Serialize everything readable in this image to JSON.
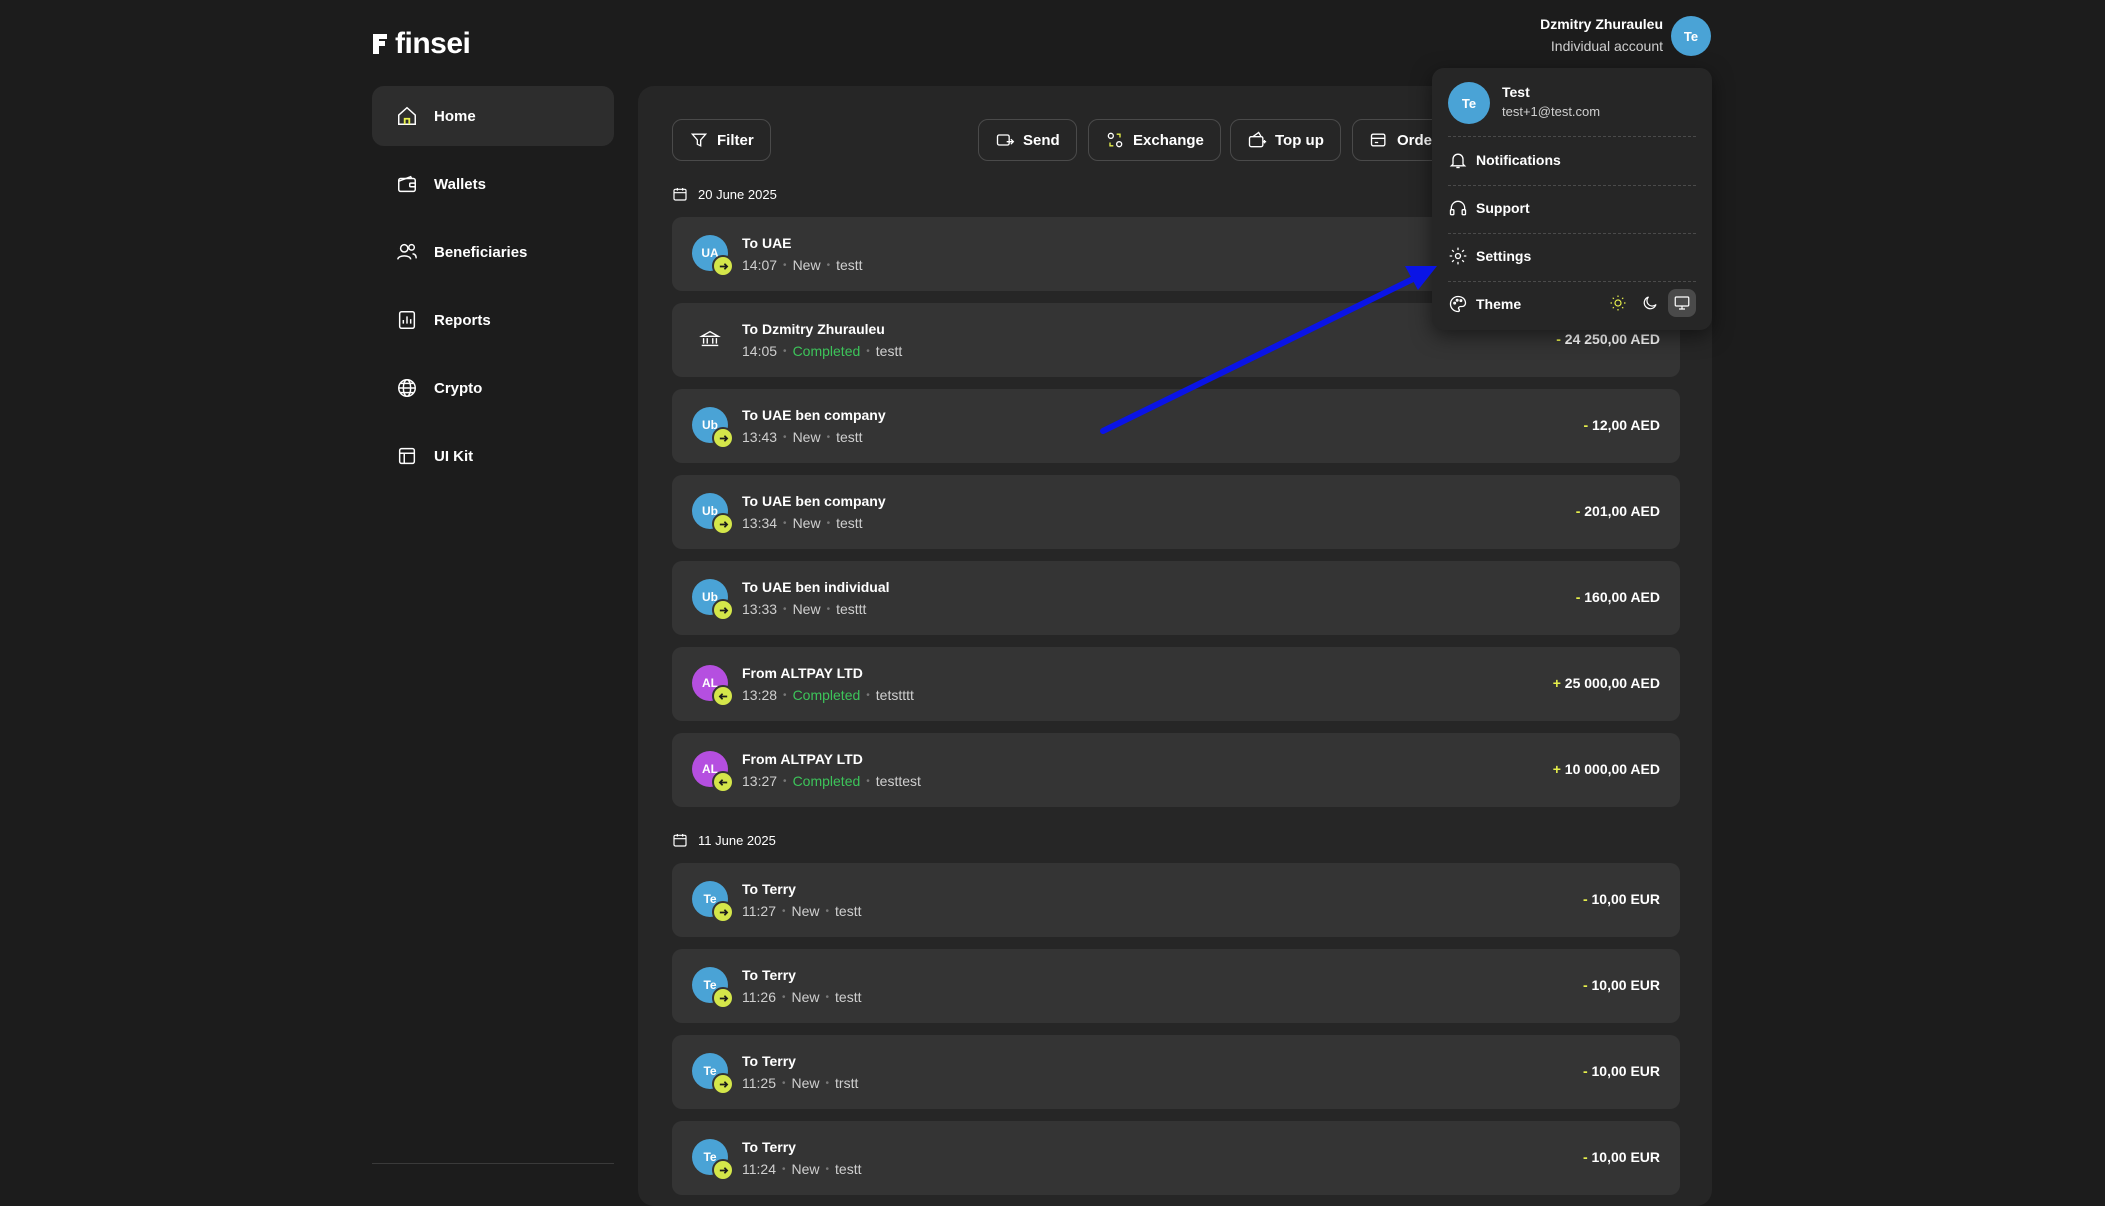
{
  "brand": {
    "logo_text": "finsei"
  },
  "sidebar": {
    "items": [
      {
        "label": "Home",
        "icon": "home-icon",
        "active": true
      },
      {
        "label": "Wallets",
        "icon": "wallet-icon"
      },
      {
        "label": "Beneficiaries",
        "icon": "users-icon"
      },
      {
        "label": "Reports",
        "icon": "reports-icon"
      },
      {
        "label": "Crypto",
        "icon": "globe-icon"
      },
      {
        "label": "UI Kit",
        "icon": "layout-icon"
      }
    ]
  },
  "user": {
    "name": "Dzmitry Zhurauleu",
    "account_type": "Individual account",
    "avatar": "Te"
  },
  "toolbar": {
    "filter": "Filter",
    "send": "Send",
    "exchange": "Exchange",
    "top_up": "Top up",
    "orders": "Orde"
  },
  "dropdown": {
    "avatar": "Te",
    "name": "Test",
    "email": "test+1@test.com",
    "notifications": "Notifications",
    "support": "Support",
    "settings": "Settings",
    "theme": "Theme",
    "theme_options": [
      "light",
      "dark",
      "system"
    ],
    "theme_selected": "system"
  },
  "groups": [
    {
      "date": "20 June 2025",
      "transactions": [
        {
          "avatar": "UA",
          "avatar_color": "#4aa3d6",
          "direction": "out",
          "title": "To UAE",
          "time": "14:07",
          "status": "New",
          "note": "testt",
          "sign": "",
          "amount": ""
        },
        {
          "avatar": "",
          "avatar_color": "bank",
          "direction": "bank",
          "title": "To Dzmitry Zhurauleu",
          "time": "14:05",
          "status": "Completed",
          "note": "testt",
          "sign": "-",
          "amount": " 24 250,00 AED"
        },
        {
          "avatar": "Ub",
          "avatar_color": "#4aa3d6",
          "direction": "out",
          "title": "To UAE ben company",
          "time": "13:43",
          "status": "New",
          "note": "testt",
          "sign": "-",
          "amount": " 12,00 AED"
        },
        {
          "avatar": "Ub",
          "avatar_color": "#4aa3d6",
          "direction": "out",
          "title": "To UAE ben company",
          "time": "13:34",
          "status": "New",
          "note": "testt",
          "sign": "-",
          "amount": " 201,00 AED"
        },
        {
          "avatar": "Ub",
          "avatar_color": "#4aa3d6",
          "direction": "out",
          "title": "To UAE ben individual",
          "time": "13:33",
          "status": "New",
          "note": "testtt",
          "sign": "-",
          "amount": " 160,00 AED"
        },
        {
          "avatar": "AL",
          "avatar_color": "#b54fe0",
          "direction": "in",
          "title": "From ALTPAY LTD",
          "time": "13:28",
          "status": "Completed",
          "note": "tetstttt",
          "sign": "+",
          "amount": " 25 000,00 AED"
        },
        {
          "avatar": "AL",
          "avatar_color": "#b54fe0",
          "direction": "in",
          "title": "From ALTPAY LTD",
          "time": "13:27",
          "status": "Completed",
          "note": "testtest",
          "sign": "+",
          "amount": " 10 000,00 AED"
        }
      ]
    },
    {
      "date": "11 June 2025",
      "transactions": [
        {
          "avatar": "Te",
          "avatar_color": "#4aa3d6",
          "direction": "out",
          "title": "To Terry",
          "time": "11:27",
          "status": "New",
          "note": "testt",
          "sign": "-",
          "amount": " 10,00 EUR"
        },
        {
          "avatar": "Te",
          "avatar_color": "#4aa3d6",
          "direction": "out",
          "title": "To Terry",
          "time": "11:26",
          "status": "New",
          "note": "testt",
          "sign": "-",
          "amount": " 10,00 EUR"
        },
        {
          "avatar": "Te",
          "avatar_color": "#4aa3d6",
          "direction": "out",
          "title": "To Terry",
          "time": "11:25",
          "status": "New",
          "note": "trstt",
          "sign": "-",
          "amount": " 10,00 EUR"
        },
        {
          "avatar": "Te",
          "avatar_color": "#4aa3d6",
          "direction": "out",
          "title": "To Terry",
          "time": "11:24",
          "status": "New",
          "note": "testt",
          "sign": "-",
          "amount": " 10,00 EUR"
        }
      ]
    }
  ],
  "colors": {
    "background": "#1c1c1c",
    "panel": "#262626",
    "row": "#343434",
    "accent": "#e7f04b",
    "completed": "#3dc45a",
    "annotation_arrow": "#0a14e6"
  }
}
